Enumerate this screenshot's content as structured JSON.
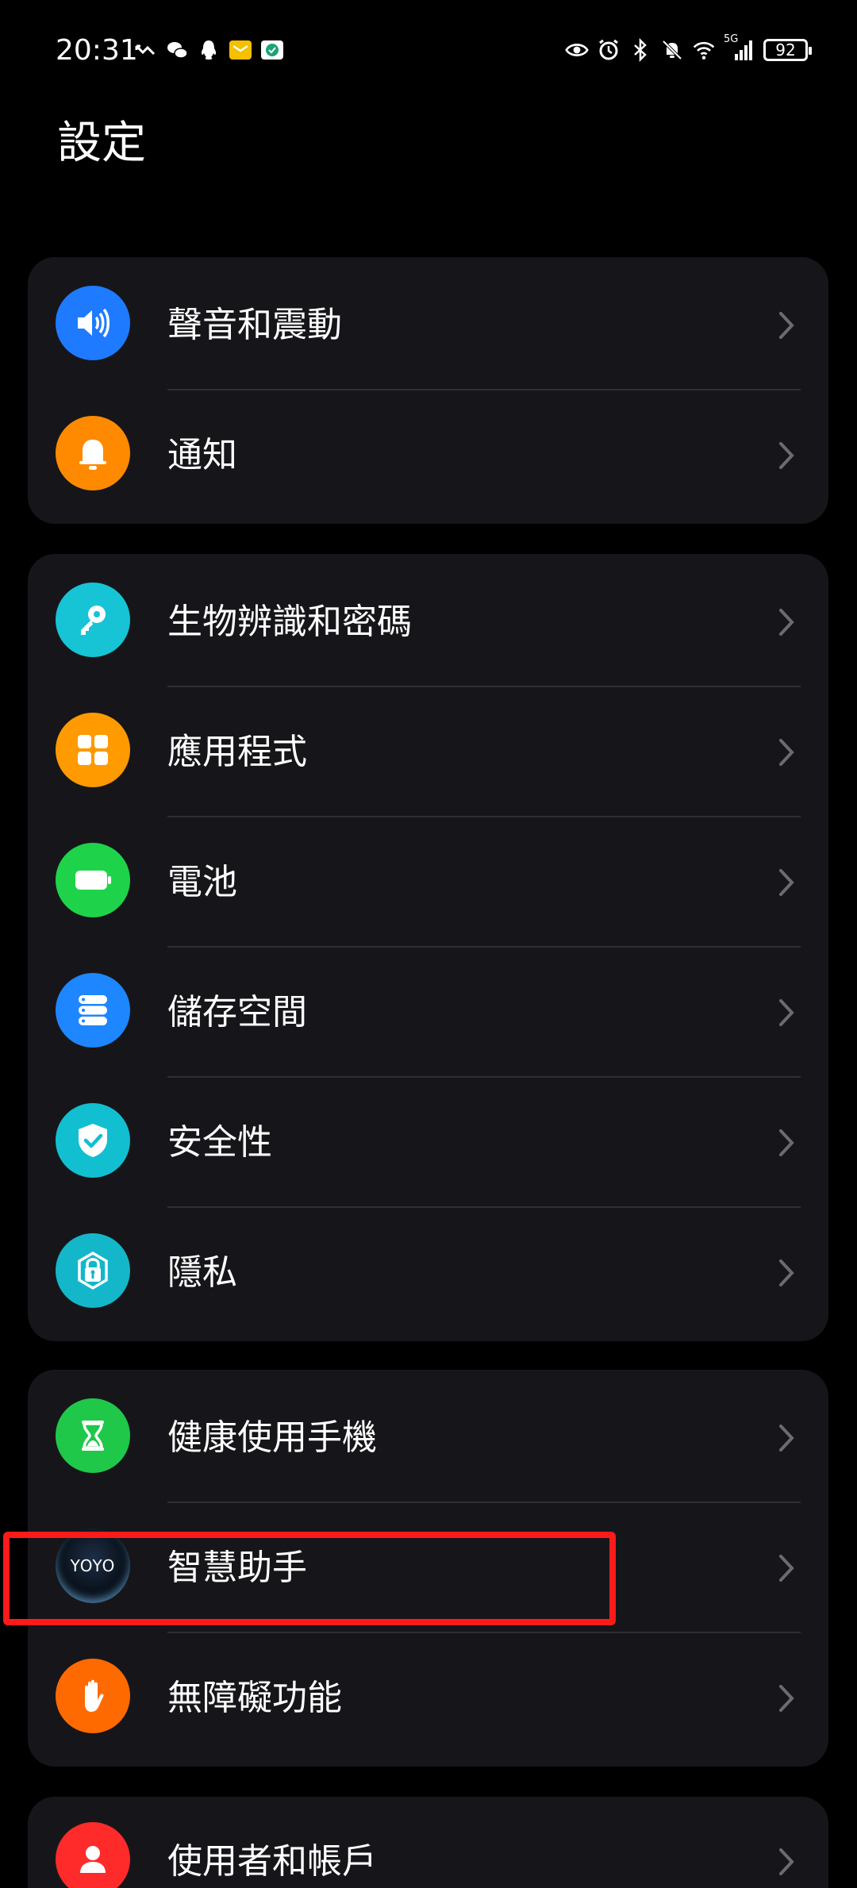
{
  "status_bar": {
    "time": "20:31",
    "network": "5G",
    "battery_level": "92"
  },
  "page": {
    "title": "設定"
  },
  "groups": [
    {
      "items": [
        {
          "label": "聲音和震動",
          "icon": "speaker-icon",
          "color": "#1e7bff"
        },
        {
          "label": "通知",
          "icon": "bell-icon",
          "color": "#ff8a00"
        }
      ]
    },
    {
      "items": [
        {
          "label": "生物辨識和密碼",
          "icon": "key-icon",
          "color": "#16c4d6"
        },
        {
          "label": "應用程式",
          "icon": "apps-grid-icon",
          "color": "#ff9a00"
        },
        {
          "label": "電池",
          "icon": "battery-icon",
          "color": "#1ed34a"
        },
        {
          "label": "儲存空間",
          "icon": "storage-icon",
          "color": "#1e86ff"
        },
        {
          "label": "安全性",
          "icon": "shield-check-icon",
          "color": "#12bfd1"
        },
        {
          "label": "隱私",
          "icon": "privacy-lock-icon",
          "color": "#13b7c9"
        }
      ]
    },
    {
      "items": [
        {
          "label": "健康使用手機",
          "icon": "hourglass-icon",
          "color": "#20c84a"
        },
        {
          "label": "智慧助手",
          "icon": "yoyo-assistant-icon",
          "color": "#0b1a2a",
          "icon_text": "YOYO"
        },
        {
          "label": "無障礙功能",
          "icon": "hand-icon",
          "color": "#ff6a00"
        }
      ]
    },
    {
      "items": [
        {
          "label": "使用者和帳戶",
          "icon": "user-icon",
          "color": "#ff2a2a"
        }
      ]
    }
  ],
  "highlight": {
    "target": "智慧助手",
    "color": "#ff1a1a"
  }
}
